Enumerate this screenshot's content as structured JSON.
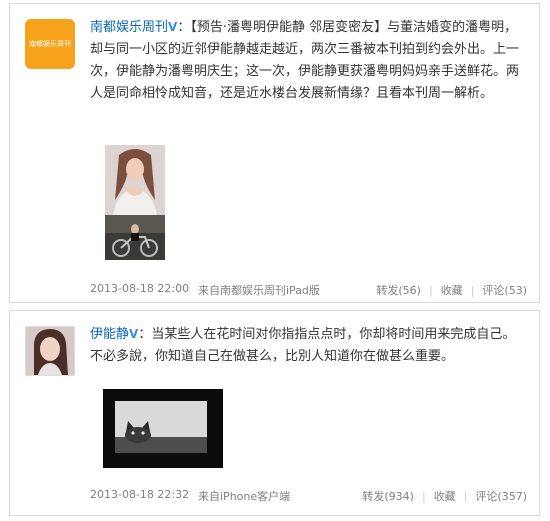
{
  "posts": [
    {
      "author": "南都娱乐周刊",
      "verified_badge": "V",
      "avatar_logo_text": "南都娱乐周刊",
      "text": "：【预告·潘粤明伊能静 邻居变密友】与董洁婚变的潘粤明，却与同一小区的近邻伊能静越走越近，两次三番被本刊拍到约会外出。上一次，伊能静为潘粤明庆生；这一次，伊能静更获潘粤明妈妈亲手送鲜花。两人是同命相怜成知音，还是近水楼台发展新情缘？且看本刊周一解析。",
      "timestamp": "2013-08-18 22:00",
      "source": "来自南都娱乐周刊iPad版",
      "actions": {
        "repost": "转发(56)",
        "favorite": "收藏",
        "comment": "评论(53)"
      },
      "images": [
        "woman-portrait",
        "motorcycle-photo"
      ]
    },
    {
      "author": "伊能静",
      "verified_badge": "V",
      "text": "：当某些人在花时间对你指指点点时，你却将时间用来完成自己。不必多說，你知道自己在做甚么，比別人知道你在做甚么重要。",
      "timestamp": "2013-08-18 22:32",
      "source": "来自iPhone客户端",
      "actions": {
        "repost": "转发(934)",
        "favorite": "收藏",
        "comment": "评论(357)"
      },
      "images": [
        "cat-photo"
      ]
    }
  ],
  "colors": {
    "author_link": "#0a68b4",
    "verified_badge": "#3a8ee6",
    "meta_text": "#808080",
    "logo_orange": "#f7a21b"
  }
}
